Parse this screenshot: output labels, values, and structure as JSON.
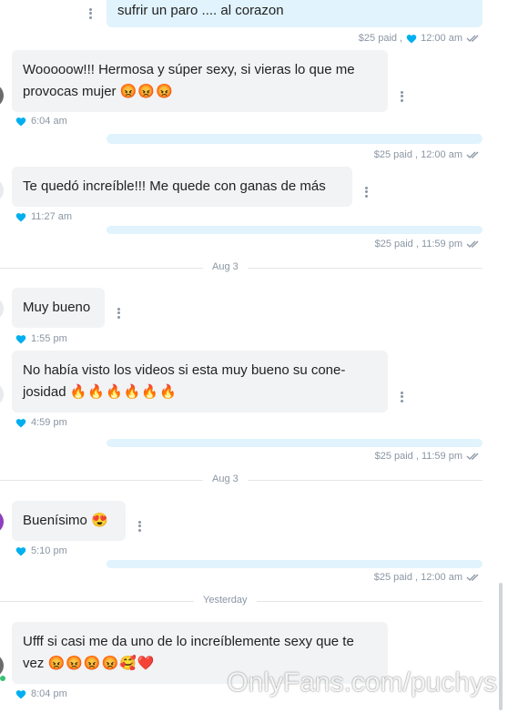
{
  "messages": [
    {
      "type": "out",
      "text": "sufrir un paro .... al corazon",
      "meta": "$25 paid ,",
      "time": "12:00 am"
    },
    {
      "type": "in",
      "line1": "Wooooow!!! Hermosa y súper sexy, si vieras lo que me",
      "line2": "provocas mujer",
      "emojis": "😡😡😡",
      "time": "6:04 am"
    },
    {
      "type": "out",
      "text": "",
      "meta": "$25 paid , 12:00 am"
    },
    {
      "type": "in",
      "text": "Te quedó increíble!!! Me quede con ganas de más",
      "time": "11:27 am"
    },
    {
      "type": "out",
      "text": "",
      "meta": "$25 paid , 11:59 pm"
    },
    {
      "type": "divider",
      "label": "Aug 3"
    },
    {
      "type": "in",
      "text": "Muy bueno",
      "time": "1:55 pm"
    },
    {
      "type": "in",
      "line1": "No había visto los videos si esta muy bueno su cone-",
      "line2": "josidad",
      "emojis": "🔥🔥🔥🔥🔥🔥",
      "time": "4:59 pm"
    },
    {
      "type": "out",
      "text": "",
      "meta": "$25 paid , 11:59 pm"
    },
    {
      "type": "divider",
      "label": "Aug 3"
    },
    {
      "type": "in",
      "text": "Buenísimo",
      "emojis": "😍",
      "time": "5:10 pm"
    },
    {
      "type": "out",
      "text": "",
      "meta": "$25 paid , 12:00 am"
    },
    {
      "type": "divider",
      "label": "Yesterday"
    },
    {
      "type": "in",
      "line1": "Ufff si casi me da uno de lo increíblemente sexy que te",
      "line2": "vez",
      "emojis": "😡😡😡😡🥰❤️",
      "time": "8:04 pm"
    }
  ],
  "watermark": "OnlyFans.com/puchys",
  "colors": {
    "accent": "#00aff0",
    "bubble_in": "#f1f3f5",
    "bubble_out": "#e1f3fd",
    "meta": "#8a96a3"
  },
  "icons": {
    "like": "heart-icon",
    "read": "double-check-icon",
    "options": "more-dots-icon"
  }
}
